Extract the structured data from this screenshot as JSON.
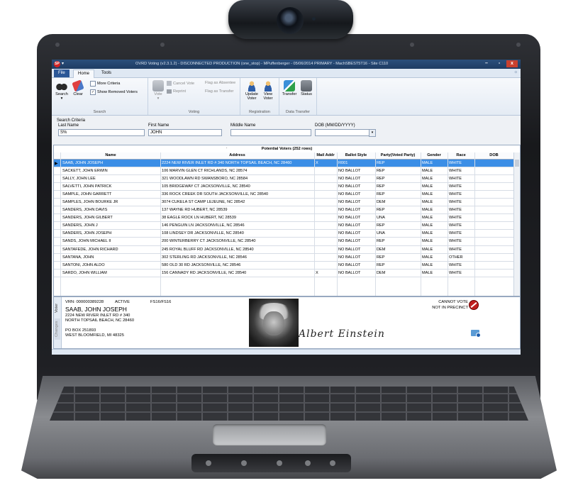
{
  "window": {
    "title": "OVRD Voting (v2.3.1.2) - DISCONNECTED PRODUCTION (one_stop) - MPuffenberger - 05/06/2014 PRIMARY - MachSBEST5T16 - Site C110",
    "app_icon": "SP",
    "qat": "▾",
    "minimize": "–",
    "maximize": "▫",
    "close": "x"
  },
  "tabs": {
    "file": "File",
    "home": "Home",
    "tools": "Tools",
    "help": "☼"
  },
  "ribbon": {
    "search_group": {
      "label": "Search",
      "search": "Search",
      "search_arrow": "▾",
      "clear": "Clear",
      "more_criteria": "More Criteria",
      "show_removed": "Show Removed Voters",
      "show_removed_checked": "✓"
    },
    "voting_group": {
      "label": "Voting",
      "vote": "Vote",
      "vote_arrow": "▾",
      "cancel_vote": "Cancel Vote",
      "reprint": "Reprint",
      "flag_absentee": "Flag as Absentee",
      "flag_transfer": "Flag as Transfer"
    },
    "registration_group": {
      "label": "Registration",
      "update_voter": "Update Voter",
      "view_voter": "View Voter"
    },
    "transfer_group": {
      "label": "Data Transfer",
      "transfer": "Transfer",
      "status": "Status"
    }
  },
  "criteria": {
    "title": "Search Criteria",
    "last_name_label": "Last Name",
    "last_name_value": "S%",
    "first_name_label": "First Name",
    "first_name_value": "JOHN",
    "middle_name_label": "Middle Name",
    "middle_name_value": "",
    "dob_label": "DOB (MM/DD/YYYY)",
    "dob_value": "",
    "dob_arrow": "▾"
  },
  "grid": {
    "dot": ".",
    "caption": "Potential Voters  (252 rows)",
    "columns": [
      "Name",
      "Address",
      "Mail Addr",
      "Ballot Style",
      "Party(Voted Party)",
      "Gender",
      "Race",
      "DOB"
    ],
    "selected_marker": "▶",
    "rows": [
      [
        "SAAB, JOHN JOSEPH",
        "2224 NEW RIVER INLET RD # 340 NORTH TOPSAIL BEACH, NC 28460",
        "X",
        "R001",
        "REP",
        "MALE",
        "WHITE",
        ""
      ],
      [
        "SACKETT, JOHN ERWIN",
        "106 MARVIN GLEN CT RICHLANDS, NC 28574",
        "",
        "NO BALLOT",
        "REP",
        "MALE",
        "WHITE",
        ""
      ],
      [
        "SALLY, JOHN LEE",
        "321 WOODLAWN RD SWANSBORO, NC 28584",
        "",
        "NO BALLOT",
        "REP",
        "MALE",
        "WHITE",
        ""
      ],
      [
        "SALVETTI, JOHN PATRICK",
        "105 BRIDGEWAY CT JACKSONVILLE, NC 28540",
        "",
        "NO BALLOT",
        "REP",
        "MALE",
        "WHITE",
        ""
      ],
      [
        "SAMPLE, JOHN GARRETT",
        "336 ROCK CREEK DR SOUTH JACKSONVILLE, NC 28540",
        "",
        "NO BALLOT",
        "REP",
        "MALE",
        "WHITE",
        ""
      ],
      [
        "SAMPLES, JOHN BOURKE JR",
        "3074 CUKELA ST CAMP LEJEUNE, NC 28542",
        "",
        "NO BALLOT",
        "DEM",
        "MALE",
        "WHITE",
        ""
      ],
      [
        "SANDERS, JOHN DAVIS",
        "137 WAYNE RD HUBERT, NC 28539",
        "",
        "NO BALLOT",
        "REP",
        "MALE",
        "WHITE",
        ""
      ],
      [
        "SANDERS, JOHN GILBERT",
        "38 EAGLE ROCK LN HUBERT, NC 28539",
        "",
        "NO BALLOT",
        "UNA",
        "MALE",
        "WHITE",
        ""
      ],
      [
        "SANDERS, JOHN J",
        "146 PENGUIN LN JACKSONVILLE, NC 28546",
        "",
        "NO BALLOT",
        "REP",
        "MALE",
        "WHITE",
        ""
      ],
      [
        "SANDERS, JOHN JOSEPH",
        "108 LINDSEY DR JACKSONVILLE, NC 28540",
        "",
        "NO BALLOT",
        "UNA",
        "MALE",
        "WHITE",
        ""
      ],
      [
        "SANDS, JOHN MICHAEL II",
        "200 WINTERBERRY CT JACKSONVILLE, NC 28540",
        "",
        "NO BALLOT",
        "REP",
        "MALE",
        "WHITE",
        ""
      ],
      [
        "SANTAFEDE, JOHN RICHARD",
        "245 ROYAL BLUFF RD JACKSONVILLE, NC 28540",
        "",
        "NO BALLOT",
        "DEM",
        "MALE",
        "WHITE",
        ""
      ],
      [
        "SANTANA, JOHN",
        "302 STERLING RD JACKSONVILLE, NC 28546",
        "",
        "NO BALLOT",
        "REP",
        "MALE",
        "OTHER",
        ""
      ],
      [
        "SANTONI, JOHN ALDO",
        "580 OLD 30 RD JACKSONVILLE, NC 28546",
        "",
        "NO BALLOT",
        "REP",
        "MALE",
        "WHITE",
        ""
      ],
      [
        "SARDO, JOHN WILLIAM",
        "156 CANNADY RD JACKSONVILLE, NC 28540",
        "X",
        "NO BALLOT",
        "DEM",
        "MALE",
        "WHITE",
        ""
      ]
    ]
  },
  "detail": {
    "tab_voter": "Voter",
    "tab_changes": "Changes",
    "vrn": "VRN: 000000389228",
    "status": "ACTIVE",
    "precinct": "FS16/FS16",
    "name": "SAAB, JOHN JOSEPH",
    "addr1": "2224 NEW RIVER INLET RD # 340",
    "addr2": "NORTH TOPSAIL BEACH, NC 28460",
    "mail1": "PO BOX 251893",
    "mail2": "WEST BLOOMFIELD, MI 48325",
    "alert1": "CANNOT VOTE",
    "alert2": "NOT IN PRECINCT",
    "signature": "Albert Einstein"
  },
  "colors": {
    "selection": "#3b8ee6",
    "titlebar": "#1e3c63",
    "file_tab": "#2b5797",
    "alert": "#c02020"
  }
}
